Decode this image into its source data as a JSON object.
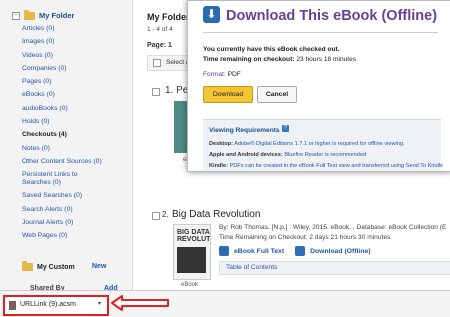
{
  "sidebar": {
    "folder_title": "My Folder",
    "collapse_glyph": "-",
    "items": [
      {
        "label": "Articles (0)",
        "active": false
      },
      {
        "label": "Images (0)",
        "active": false
      },
      {
        "label": "Videos (0)",
        "active": false
      },
      {
        "label": "Companies (0)",
        "active": false
      },
      {
        "label": "Pages (0)",
        "active": false
      },
      {
        "label": "eBooks (0)",
        "active": false
      },
      {
        "label": "audioBooks (0)",
        "active": false
      },
      {
        "label": "Holds (0)",
        "active": false
      },
      {
        "label": "Checkouts (4)",
        "active": true
      },
      {
        "label": "Notes (0)",
        "active": false
      },
      {
        "label": "Other Content Sources (0)",
        "active": false
      },
      {
        "label": "Persistent Links to",
        "active": false
      },
      {
        "label": "Searches (0)",
        "active": false
      },
      {
        "label": "Saved Searches (0)",
        "active": false
      },
      {
        "label": "Search Alerts (0)",
        "active": false
      },
      {
        "label": "Journal Alerts (0)",
        "active": false
      },
      {
        "label": "Web Pages (0)",
        "active": false
      }
    ],
    "my_custom": "My Custom",
    "new_label": "New",
    "shared_by": "Shared By",
    "add_label": "Add"
  },
  "main": {
    "title": "My Folder:",
    "page_count": "1 - 4 of 4",
    "page_label": "Page: 1",
    "select_label": "Select /",
    "row1": {
      "title": "1. Pers",
      "ebook": "eBook"
    },
    "row2": {
      "num": "2.",
      "title": "Big Data Revolution",
      "cover_text": "BIG DATA REVOLUTION",
      "meta1": "By: Rob Thomas. [N.p.] : Wiley. 2015. eBook. , Database: eBook Collection (E",
      "meta2": "Time Remaining on Checkout: 2 days 21 hours 30 minutes",
      "full_text": "eBook Full Text",
      "download": "Download (Offline)",
      "toc": "Table of Contents",
      "ebook": "eBook"
    }
  },
  "modal": {
    "icon_glyph": "⬇",
    "title": "Download This eBook (Offline)",
    "line1": "You currently have this eBook checked out.",
    "line2_label": "Time remaining on checkout:",
    "line2_value": "23 hours 18 minutes",
    "format_label": "Format:",
    "format_value": "PDF",
    "download_btn": "Download",
    "cancel_btn": "Cancel",
    "req_title": "Viewing Requirements",
    "help_glyph": "?",
    "desktop_label": "Desktop:",
    "desktop_link": "Adobe® Digital Editions 1.7.1 or higher is required for offline viewing.",
    "mobile_label": "Apple and Android devices:",
    "mobile_link": "Bluefire Reader is recommended",
    "kindle_label": "Kindle:",
    "kindle_text": "PDFs can be created in the eBook Full Text view and transferred using Send To Kindle"
  },
  "download_bar": {
    "filename": "URLLink (9).acsm",
    "caret": "▾"
  },
  "colors": {
    "accent_purple": "#6a3f97",
    "link_blue": "#2255aa",
    "download_yellow": "#f3c534",
    "highlight_red": "#d22222"
  }
}
